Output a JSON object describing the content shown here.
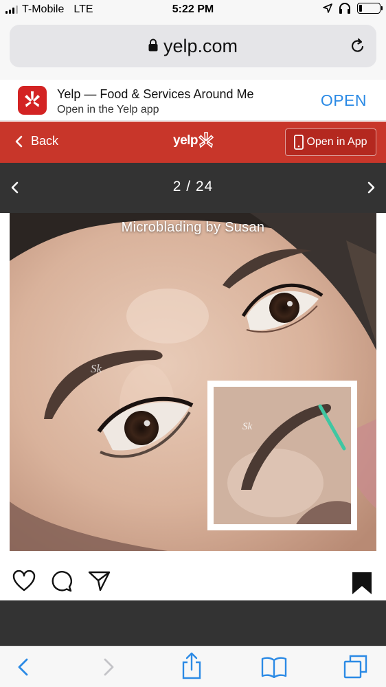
{
  "status_bar": {
    "carrier": "T-Mobile",
    "network": "LTE",
    "time": "5:22 PM",
    "signal_bars_active": 3,
    "signal_bars_total": 4,
    "battery_level": 0.15,
    "icons": [
      "location-arrow-icon",
      "headphones-icon",
      "battery-icon"
    ]
  },
  "url_bar": {
    "domain": "yelp.com",
    "icons": [
      "lock-icon",
      "reload-icon"
    ]
  },
  "app_banner": {
    "title": "Yelp — Food & Services Around Me",
    "subtitle": "Open in the Yelp app",
    "open_label": "OPEN",
    "accent": "#2b8ae5"
  },
  "yelp_header": {
    "back_label": "Back",
    "logo_text": "yelp",
    "open_in_app_label": "Open in App",
    "brand_color": "#c8362a"
  },
  "gallery": {
    "counter": "2 / 24",
    "caption": "Microblading by Susan"
  },
  "social_icons": [
    "heart-icon",
    "comment-icon",
    "share-icon",
    "bookmark-icon"
  ],
  "toolbar_icons": [
    "back-icon",
    "forward-icon",
    "share-icon",
    "bookmarks-icon",
    "tabs-icon"
  ]
}
